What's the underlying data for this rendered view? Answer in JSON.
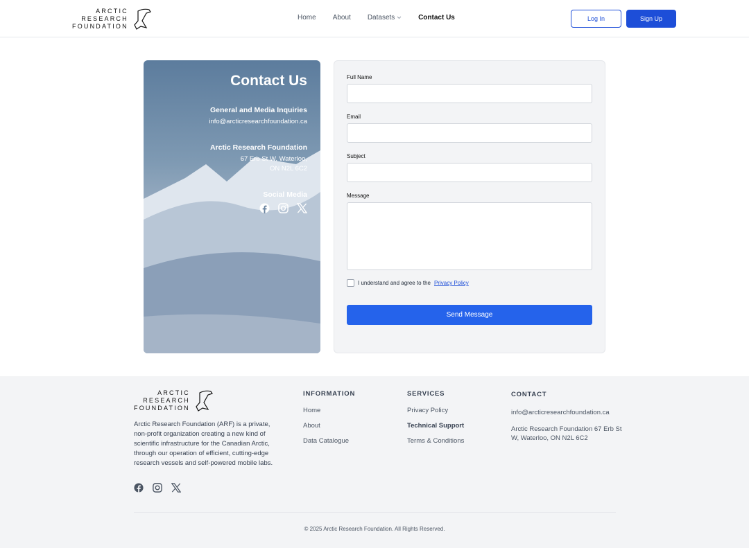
{
  "header": {
    "logo_lines": [
      "ARCTIC",
      "RESEARCH",
      "FOUNDATION"
    ],
    "nav": [
      "Home",
      "About",
      "Datasets",
      "Contact Us"
    ],
    "login": "Log In",
    "signup": "Sign Up"
  },
  "contact_card": {
    "title": "Contact Us",
    "inquiries_title": "General and Media Inquiries",
    "email": "info@arcticresearchfoundation.ca",
    "org_title": "Arctic Research Foundation",
    "address_line1": "67 Erb St W, Waterloo,",
    "address_line2": "ON N2L 6C2",
    "social_title": "Social Media",
    "social_icons": [
      "facebook-icon",
      "instagram-icon",
      "x-icon"
    ]
  },
  "form": {
    "full_name": "Full Name",
    "email": "Email",
    "subject": "Subject",
    "message": "Message",
    "agree_text": "I understand and agree to the",
    "privacy_link": "Privacy Policy",
    "send": "Send Message"
  },
  "footer": {
    "about": "Arctic Research Foundation (ARF) is a private, non-profit organization creating a new kind of scientific infrastructure for the Canadian Arctic, through our operation of efficient, cutting-edge research vessels and self-powered mobile labs.",
    "information": {
      "title": "INFORMATION",
      "links": [
        "Home",
        "About",
        "Data Catalogue"
      ]
    },
    "services": {
      "title": "SERVICES",
      "links": [
        "Privacy Policy",
        "Technical Support",
        "Terms & Conditions"
      ]
    },
    "contact": {
      "title": "CONTACT",
      "email": "info@arcticresearchfoundation.ca",
      "address": "Arctic Research Foundation 67 Erb St W, Waterloo, ON N2L 6C2"
    },
    "copyright": "© 2025 Arctic Research Foundation. All Rights Reserved."
  },
  "colors": {
    "primary": "#1d4ed8",
    "send_button": "#2563eb"
  }
}
